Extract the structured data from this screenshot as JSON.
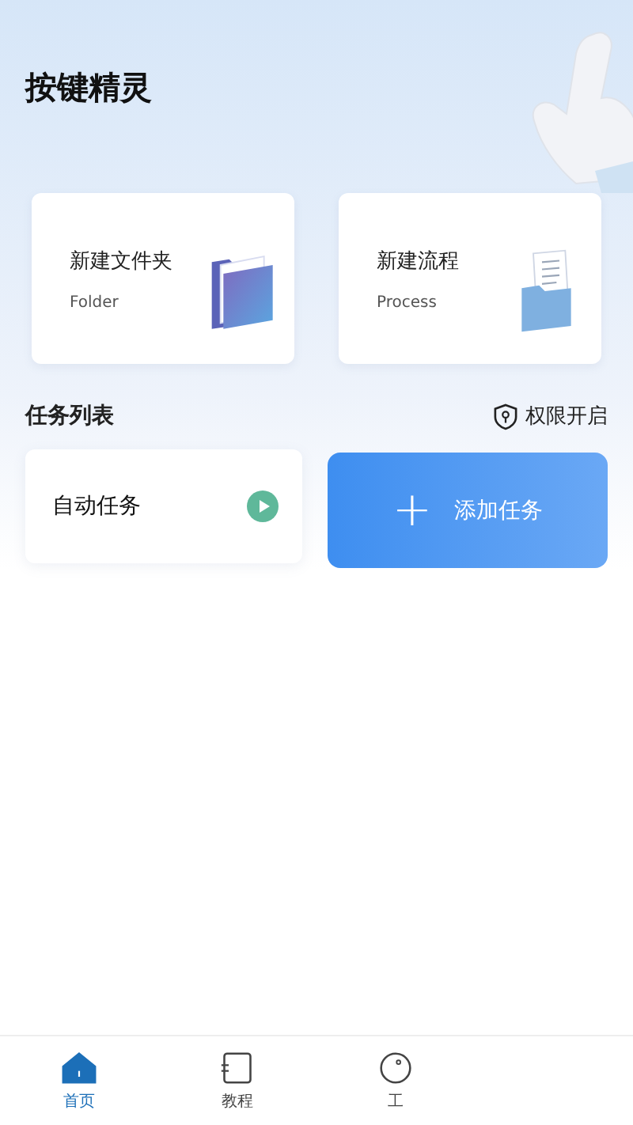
{
  "app_title": "按键精灵",
  "cards": [
    {
      "kind": "folder",
      "title": "新建文件夹",
      "subtitle": "Folder"
    },
    {
      "kind": "process",
      "title": "新建流程",
      "subtitle": "Process"
    }
  ],
  "task_section": {
    "title": "任务列表",
    "permission": "权限开启"
  },
  "tasks": [
    {
      "name": "自动任务"
    }
  ],
  "add_button": {
    "plus": "+",
    "label": "添加任务"
  },
  "nav": [
    {
      "kind": "home",
      "label": "首页",
      "selected": true
    },
    {
      "kind": "tutorial",
      "label": "教程",
      "selected": false
    },
    {
      "kind": "tools",
      "label": "工",
      "selected": false
    }
  ]
}
